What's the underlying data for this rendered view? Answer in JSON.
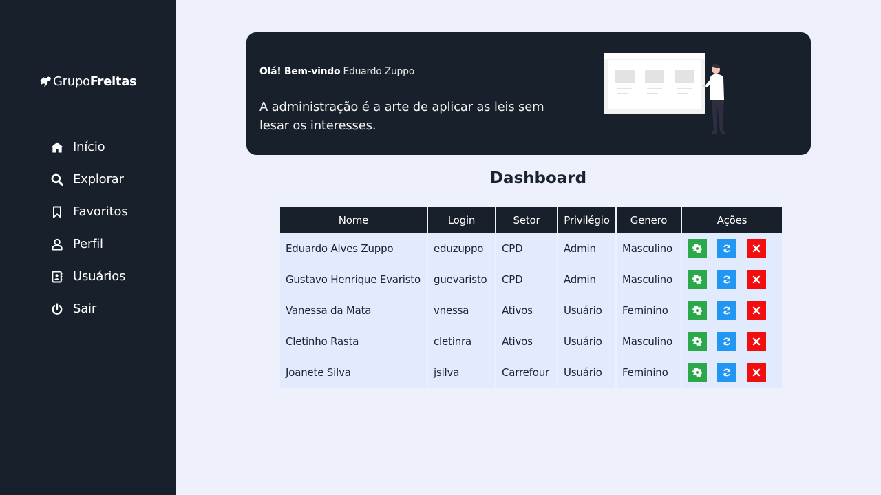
{
  "sidebar": {
    "logo": {
      "light": "Grupo",
      "bold": "Freitas",
      "icon": "dog-icon"
    },
    "items": [
      {
        "label": "Início",
        "icon": "home-icon"
      },
      {
        "label": "Explorar",
        "icon": "search-icon"
      },
      {
        "label": "Favoritos",
        "icon": "bookmark-icon"
      },
      {
        "label": "Perfil",
        "icon": "user-icon"
      },
      {
        "label": "Usuários",
        "icon": "address-book-icon"
      },
      {
        "label": "Sair",
        "icon": "power-icon"
      }
    ]
  },
  "banner": {
    "greeting_bold": "Olá! Bem-vindo",
    "user_name": "Eduardo Zuppo",
    "quote": "A administração é a arte de aplicar as leis sem lesar os interesses."
  },
  "dashboard": {
    "title": "Dashboard",
    "columns": [
      "Nome",
      "Login",
      "Setor",
      "Privilégio",
      "Genero",
      "Ações"
    ],
    "rows": [
      {
        "nome": "Eduardo Alves Zuppo",
        "login": "eduzuppo",
        "setor": "CPD",
        "privilegio": "Admin",
        "genero": "Masculino"
      },
      {
        "nome": "Gustavo Henrique Evaristo",
        "login": "guevaristo",
        "setor": "CPD",
        "privilegio": "Admin",
        "genero": "Masculino"
      },
      {
        "nome": "Vanessa da Mata",
        "login": "vnessa",
        "setor": "Ativos",
        "privilegio": "Usuário",
        "genero": "Feminino"
      },
      {
        "nome": "Cletinho Rasta",
        "login": "cletinra",
        "setor": "Ativos",
        "privilegio": "Usuário",
        "genero": "Masculino"
      },
      {
        "nome": "Joanete Silva",
        "login": "jsilva",
        "setor": "Carrefour",
        "privilegio": "Usuário",
        "genero": "Feminino"
      }
    ],
    "actions": [
      {
        "icon": "gear-icon",
        "color": "#2aa84a"
      },
      {
        "icon": "refresh-icon",
        "color": "#2196f3"
      },
      {
        "icon": "close-icon",
        "color": "#f20e0e"
      }
    ]
  },
  "colors": {
    "sidebar_bg": "#18202b",
    "page_bg": "#eef1fc",
    "row_bg": "#e1ebfd"
  }
}
